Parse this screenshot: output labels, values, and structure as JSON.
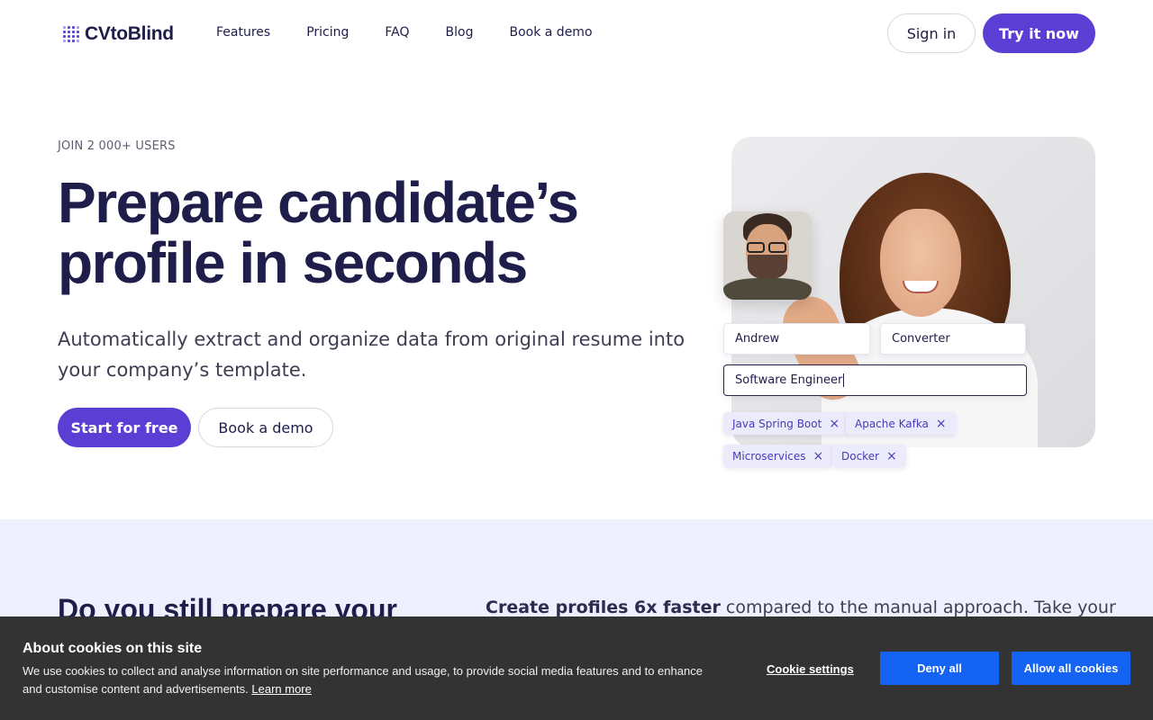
{
  "brand": {
    "name": "CVtoBlind",
    "accent": "#5b3fd4",
    "dark": "#1f1d4a"
  },
  "nav": {
    "items": [
      {
        "label": "Features"
      },
      {
        "label": "Pricing"
      },
      {
        "label": "FAQ"
      },
      {
        "label": "Blog"
      },
      {
        "label": "Book a demo"
      }
    ],
    "signin_label": "Sign in",
    "try_label": "Try it now"
  },
  "hero": {
    "eyebrow": "JOIN 2 000+ USERS",
    "title_line1": "Prepare candidate’s",
    "title_line2": "profile in seconds",
    "subtitle": "Automatically extract and organize data from original resume into your company’s template.",
    "start_label": "Start for free",
    "demo_label": "Book a demo"
  },
  "form_demo": {
    "first_name": "Andrew",
    "last_name": "Converter",
    "job_title": "Software Engineer",
    "tags": [
      {
        "label": "Java Spring Boot",
        "remove": "×"
      },
      {
        "label": "Apache Kafka",
        "remove": "×"
      },
      {
        "label": "Microservices",
        "remove": "×"
      },
      {
        "label": "Docker",
        "remove": "×"
      }
    ]
  },
  "section2": {
    "title": "Do you still prepare your",
    "text_bold": "Create profiles 6x faster",
    "text_rest": " compared to the manual approach. Take your"
  },
  "cookie": {
    "title": "About cookies on this site",
    "text": "We use cookies to collect and analyse information on site performance and usage, to provide social media features and to enhance and customise content and advertisements.",
    "learn_more": "Learn more",
    "settings_label": "Cookie settings",
    "deny_label": "Deny all",
    "allow_label": "Allow all cookies",
    "button_color": "#1463f3",
    "background": "#333333"
  }
}
